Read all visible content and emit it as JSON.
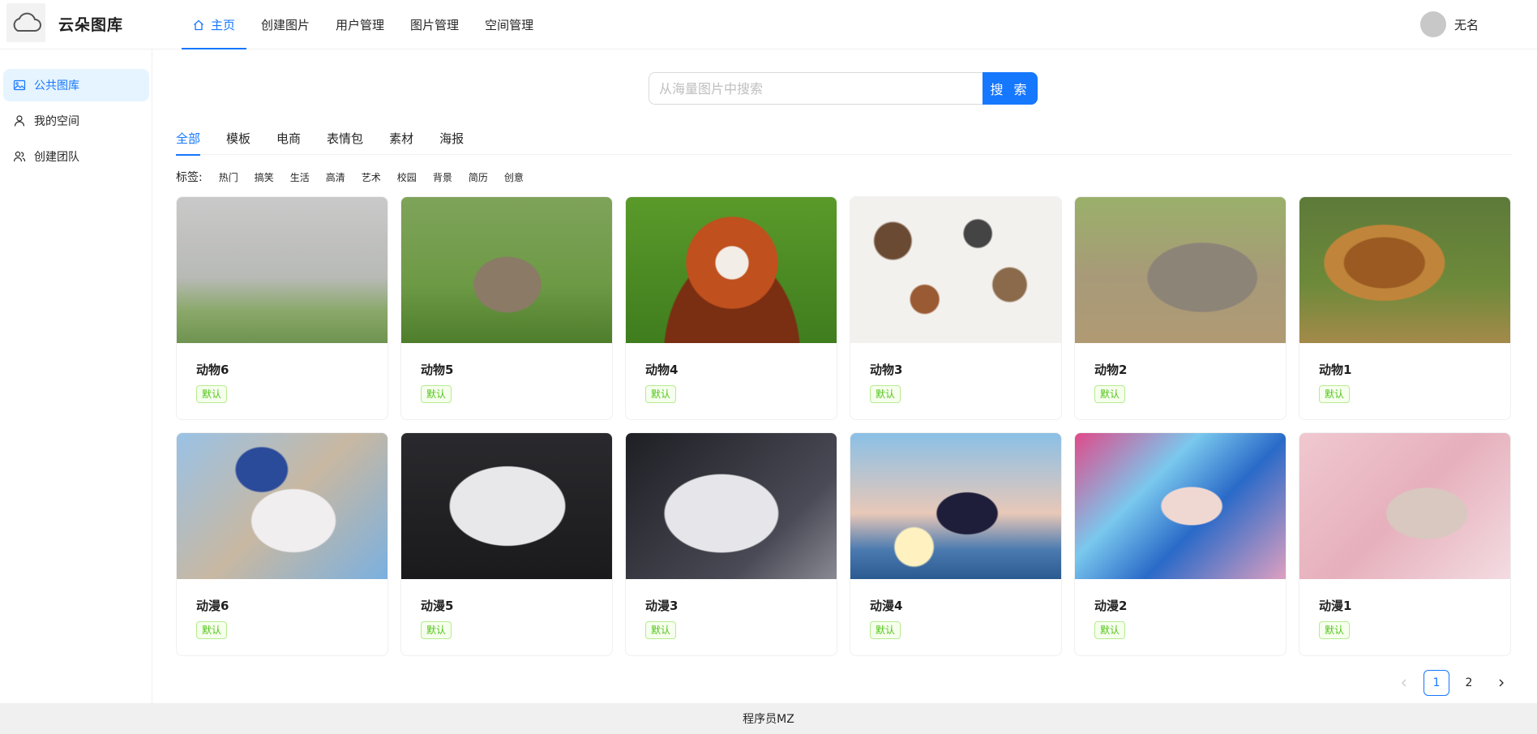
{
  "header": {
    "brand": "云朵图库",
    "nav": [
      {
        "label": "主页",
        "active": true
      },
      {
        "label": "创建图片"
      },
      {
        "label": "用户管理"
      },
      {
        "label": "图片管理"
      },
      {
        "label": "空间管理"
      }
    ],
    "user_name": "无名"
  },
  "sidebar": {
    "items": [
      {
        "label": "公共图库",
        "icon": "picture-icon",
        "active": true
      },
      {
        "label": "我的空间",
        "icon": "user-icon"
      },
      {
        "label": "创建团队",
        "icon": "team-icon"
      }
    ]
  },
  "search": {
    "placeholder": "从海量图片中搜索",
    "value": "",
    "button_label": "搜 索"
  },
  "tabs": [
    "全部",
    "模板",
    "电商",
    "表情包",
    "素材",
    "海报"
  ],
  "tags": {
    "label": "标签:",
    "items": [
      "热门",
      "搞笑",
      "生活",
      "高清",
      "艺术",
      "校园",
      "背景",
      "简历",
      "创意"
    ]
  },
  "pictures": [
    {
      "title": "动物6",
      "category": "默认",
      "thumb": "horses"
    },
    {
      "title": "动物5",
      "category": "默认",
      "thumb": "rabbit"
    },
    {
      "title": "动物4",
      "category": "默认",
      "thumb": "panda"
    },
    {
      "title": "动物3",
      "category": "默认",
      "thumb": "animals"
    },
    {
      "title": "动物2",
      "category": "默认",
      "thumb": "rhino"
    },
    {
      "title": "动物1",
      "category": "默认",
      "thumb": "lion"
    },
    {
      "title": "动漫6",
      "category": "默认",
      "thumb": "anime6"
    },
    {
      "title": "动漫5",
      "category": "默认",
      "thumb": "anime5"
    },
    {
      "title": "动漫3",
      "category": "默认",
      "thumb": "anime3"
    },
    {
      "title": "动漫4",
      "category": "默认",
      "thumb": "anime4"
    },
    {
      "title": "动漫2",
      "category": "默认",
      "thumb": "anime2"
    },
    {
      "title": "动漫1",
      "category": "默认",
      "thumb": "anime1"
    }
  ],
  "pagination": {
    "prev": "<",
    "pages": [
      "1",
      "2"
    ],
    "current": "1",
    "next": ">"
  },
  "footer": {
    "text": "程序员MZ"
  },
  "colors": {
    "accent": "#1677ff",
    "tag_green": "#52c41a",
    "footer_bg": "#f0f0f0"
  }
}
